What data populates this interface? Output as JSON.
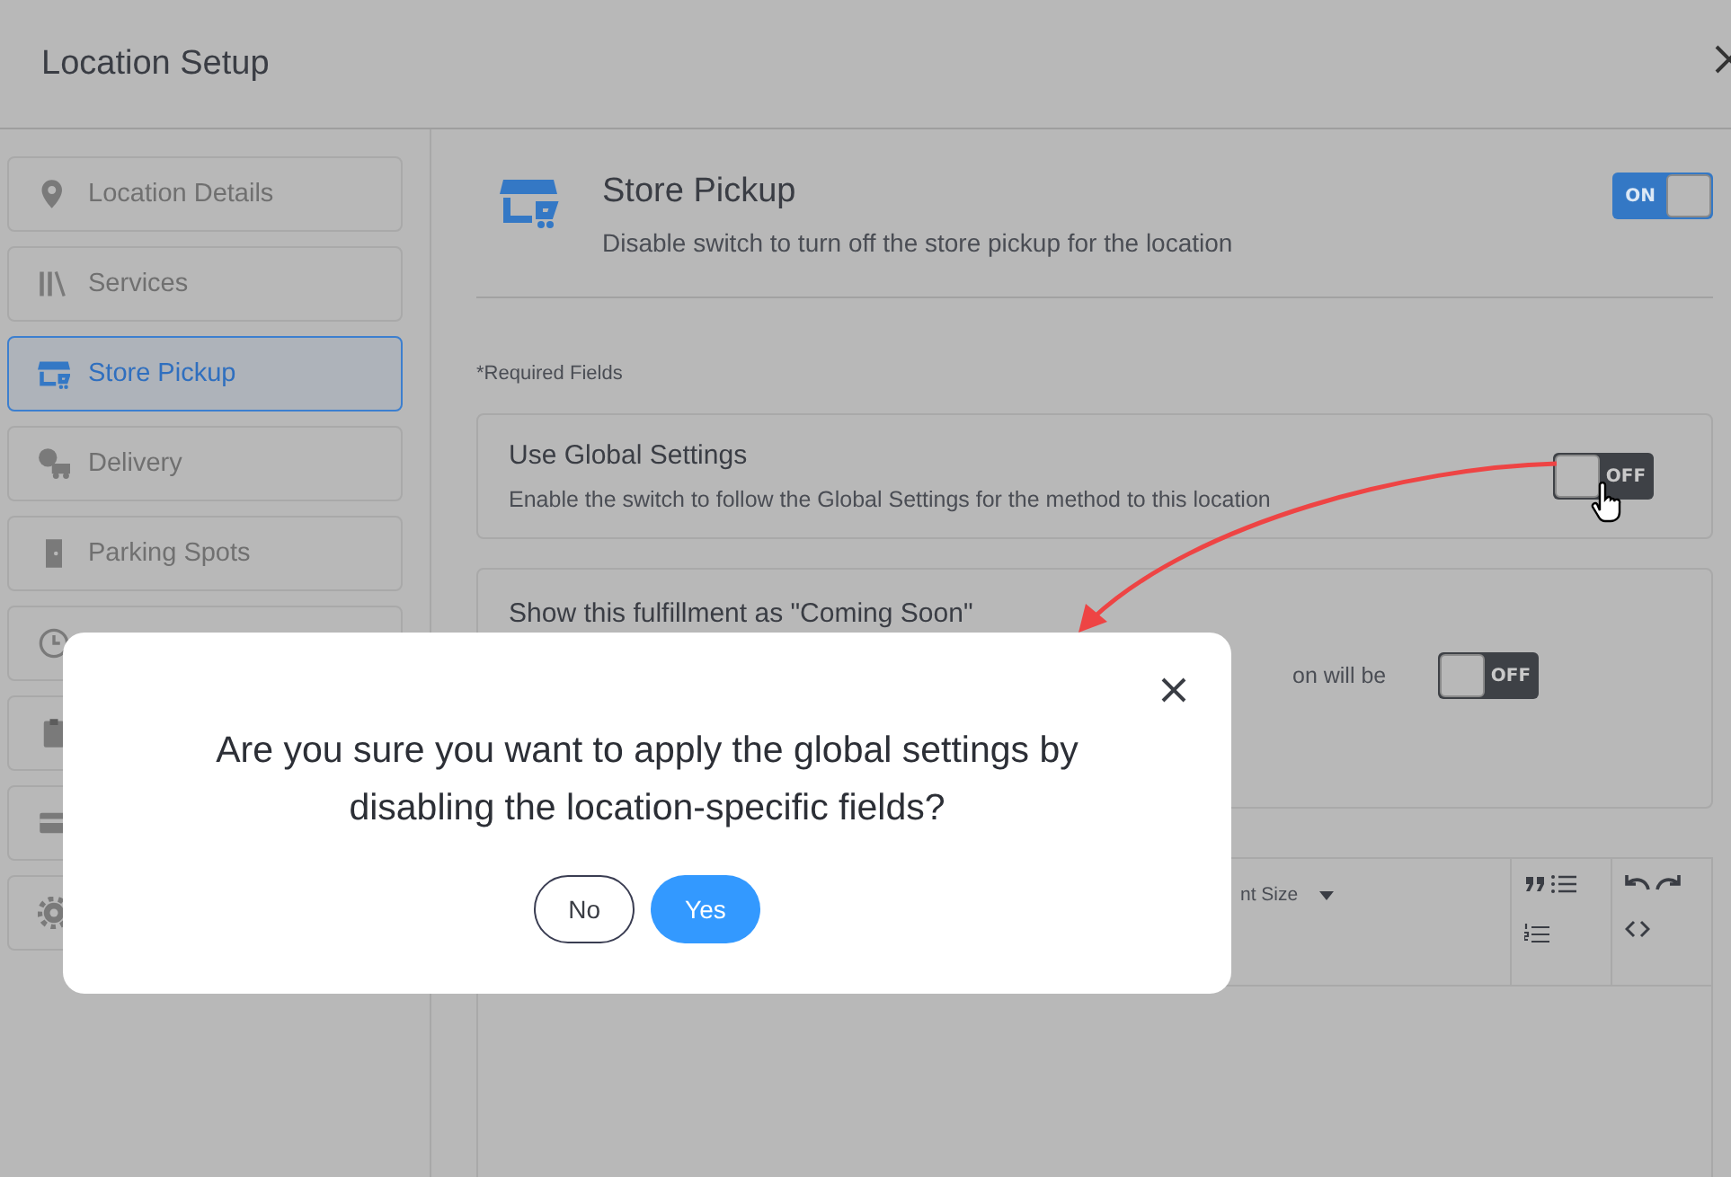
{
  "window": {
    "title": "Location Setup"
  },
  "sidebar": {
    "items": [
      {
        "label": "Location Details",
        "selected": false
      },
      {
        "label": "Services",
        "selected": false
      },
      {
        "label": "Store Pickup",
        "selected": true
      },
      {
        "label": "Delivery",
        "selected": false
      },
      {
        "label": "Parking Spots",
        "selected": false
      },
      {
        "selected": false
      },
      {
        "selected": false
      },
      {
        "selected": false
      },
      {
        "selected": false
      }
    ]
  },
  "section": {
    "title": "Store Pickup",
    "description": "Disable switch to turn off the store pickup for the location",
    "toggle": {
      "on": true,
      "label": "ON"
    }
  },
  "required_note": "*Required Fields",
  "settings": [
    {
      "title": "Use Global Settings",
      "description": "Enable the switch to follow the Global Settings for the method to this location",
      "toggle": {
        "on": false,
        "label": "OFF"
      }
    },
    {
      "title": "Show this fulfillment as \"Coming Soon\"",
      "description": "on will be",
      "toggle": {
        "on": false,
        "label": "OFF"
      }
    }
  ],
  "editor": {
    "font_size_label": "nt Size"
  },
  "dialog": {
    "message": "Are you sure you want to apply the global settings by disabling the location-specific fields?",
    "buttons": [
      {
        "label": "No",
        "kind": "secondary"
      },
      {
        "label": "Yes",
        "kind": "primary"
      }
    ]
  }
}
